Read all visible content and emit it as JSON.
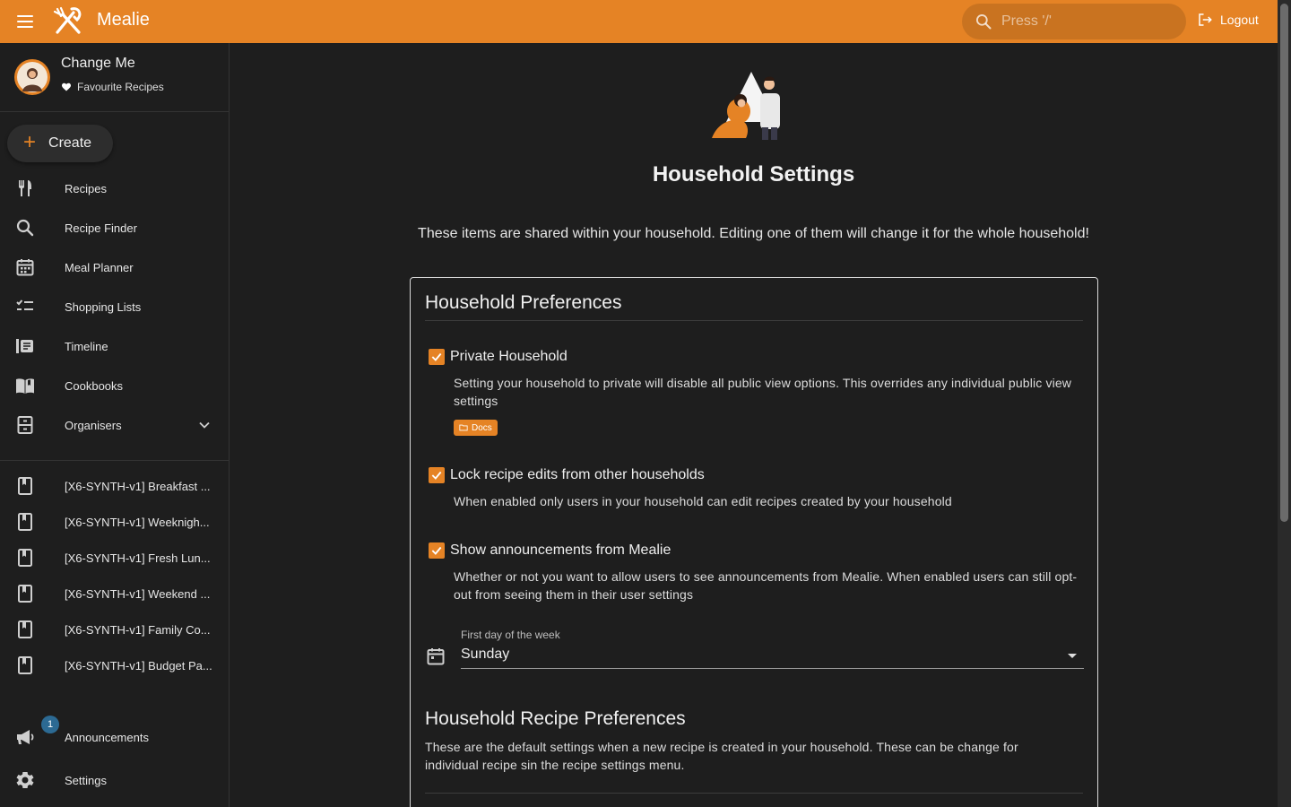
{
  "app": {
    "title": "Mealie",
    "brand_color": "#e58325"
  },
  "search": {
    "placeholder": "Press '/'"
  },
  "header": {
    "logout_label": "Logout"
  },
  "user": {
    "name": "Change Me",
    "favourites_label": "Favourite Recipes"
  },
  "sidebar": {
    "create_label": "Create",
    "nav": [
      {
        "label": "Recipes",
        "icon": "fork-knife-icon"
      },
      {
        "label": "Recipe Finder",
        "icon": "search-icon"
      },
      {
        "label": "Meal Planner",
        "icon": "calendar-icon"
      },
      {
        "label": "Shopping Lists",
        "icon": "checklist-icon"
      },
      {
        "label": "Timeline",
        "icon": "timeline-icon"
      },
      {
        "label": "Cookbooks",
        "icon": "book-open-icon"
      },
      {
        "label": "Organisers",
        "icon": "cabinet-icon"
      }
    ],
    "cookbooks": [
      {
        "label": "[X6-SYNTH-v1] Breakfast ..."
      },
      {
        "label": "[X6-SYNTH-v1] Weeknigh..."
      },
      {
        "label": "[X6-SYNTH-v1] Fresh Lun..."
      },
      {
        "label": "[X6-SYNTH-v1] Weekend ..."
      },
      {
        "label": "[X6-SYNTH-v1] Family Co..."
      },
      {
        "label": "[X6-SYNTH-v1] Budget Pa..."
      }
    ],
    "announcements_label": "Announcements",
    "announcements_badge": "1",
    "settings_label": "Settings"
  },
  "page": {
    "title": "Household Settings",
    "description": "These items are shared within your household. Editing one of them will change it for the whole household!"
  },
  "preferences": {
    "heading": "Household Preferences",
    "private": {
      "label": "Private Household",
      "checked": true,
      "help": "Setting your household to private will disable all public view options. This overrides any individual public view settings",
      "docs_label": "Docs"
    },
    "lock": {
      "label": "Lock recipe edits from other households",
      "checked": true,
      "help": "When enabled only users in your household can edit recipes created by your household"
    },
    "announcements": {
      "label": "Show announcements from Mealie",
      "checked": true,
      "help": "Whether or not you want to allow users to see announcements from Mealie. When enabled users can still opt-out from seeing them in their user settings"
    },
    "first_day": {
      "label": "First day of the week",
      "value": "Sunday"
    }
  },
  "recipe_preferences": {
    "heading": "Household Recipe Preferences",
    "description": "These are the default settings when a new recipe is created in your household. These can be change for individual recipe sin the recipe settings menu."
  }
}
